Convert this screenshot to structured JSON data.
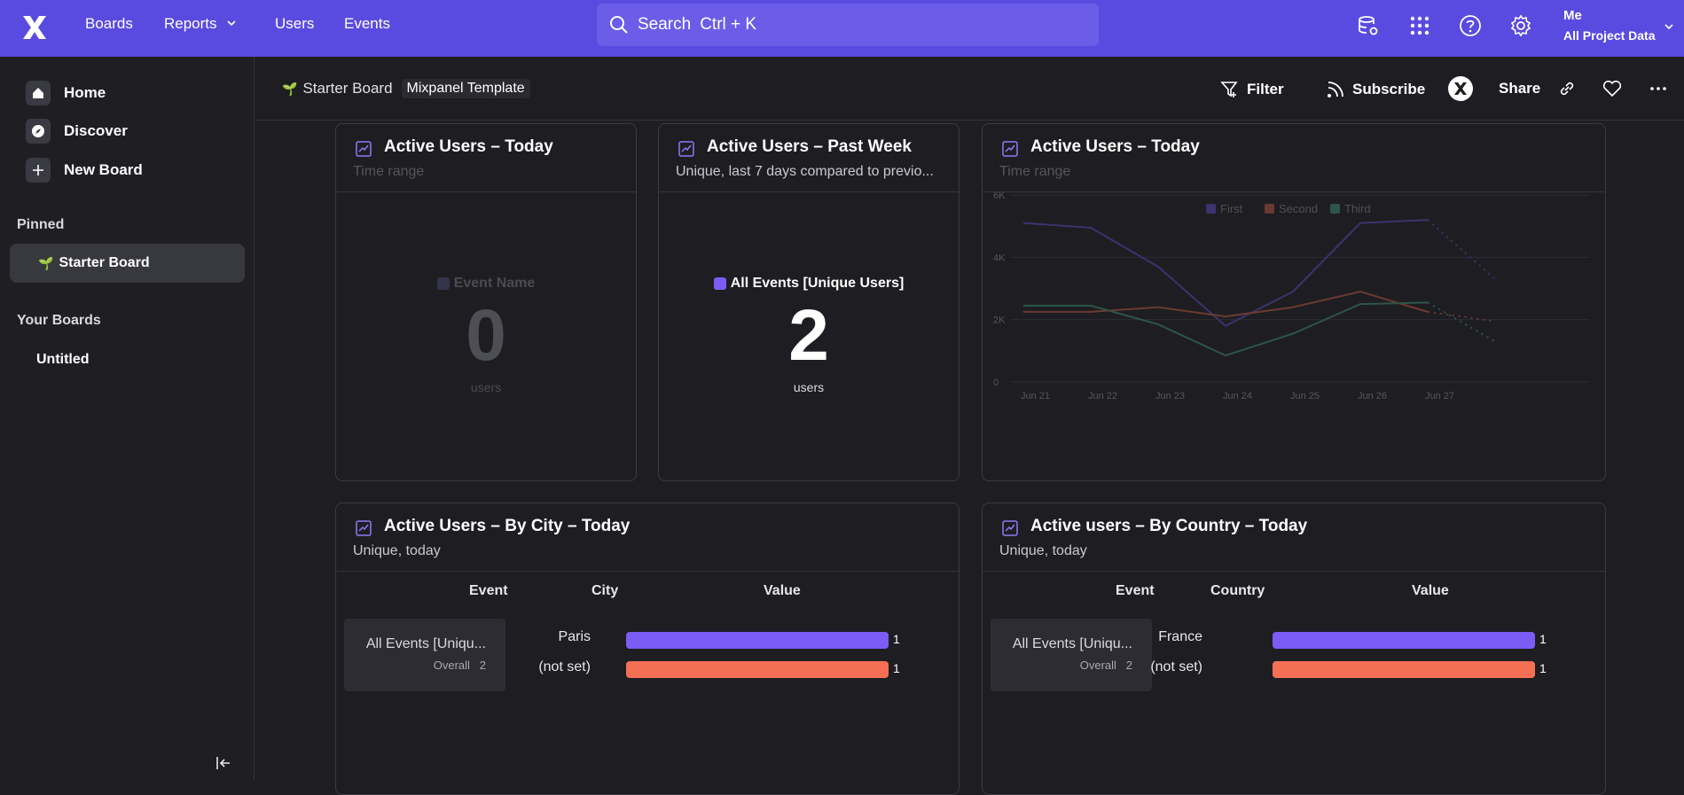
{
  "topbar": {
    "nav": [
      "Boards",
      "Reports",
      "Users",
      "Events"
    ],
    "search_label": "Search",
    "search_shortcut": "Ctrl + K",
    "user_name": "Me",
    "user_project": "All Project Data"
  },
  "sidebar": {
    "items": [
      {
        "label": "Home",
        "icon": "home-icon"
      },
      {
        "label": "Discover",
        "icon": "compass-icon"
      },
      {
        "label": "New Board",
        "icon": "plus-icon"
      }
    ],
    "pinned_heading": "Pinned",
    "pinned_item": "Starter Board",
    "boards_heading": "Your Boards",
    "boards": [
      "Untitled"
    ]
  },
  "board": {
    "name": "Starter Board",
    "template_tag": "Mixpanel Template",
    "actions": {
      "filter": "Filter",
      "subscribe": "Subscribe",
      "share": "Share"
    }
  },
  "cards": {
    "today": {
      "title": "Active Users – Today",
      "subtitle": "Time range",
      "metric_label": "Event Name",
      "metric_value": "0",
      "metric_unit": "users"
    },
    "week": {
      "title": "Active Users – Past Week",
      "subtitle": "Unique, last 7 days compared to previo...",
      "metric_label": "All Events [Unique Users]",
      "metric_value": "2",
      "metric_unit": "users"
    },
    "line": {
      "title": "Active Users – Today",
      "subtitle": "Time range"
    },
    "city": {
      "title": "Active Users – By City – Today",
      "subtitle": "Unique, today",
      "headers": [
        "Event",
        "City",
        "Value"
      ],
      "event_name": "All Events [Uniqu...",
      "overall_label": "Overall",
      "overall_value": "2",
      "rows": [
        {
          "label": "Paris",
          "value": "1",
          "color": "#7b5cf5"
        },
        {
          "label": "(not set)",
          "value": "1",
          "color": "#f56f55"
        }
      ]
    },
    "country": {
      "title": "Active users – By Country – Today",
      "subtitle": "Unique, today",
      "headers": [
        "Event",
        "Country",
        "Value"
      ],
      "event_name": "All Events [Uniqu...",
      "overall_label": "Overall",
      "overall_value": "2",
      "rows": [
        {
          "label": "France",
          "value": "1",
          "color": "#7b5cf5"
        },
        {
          "label": "(not set)",
          "value": "1",
          "color": "#f56f55"
        }
      ]
    }
  },
  "chart_data": {
    "type": "line",
    "categories": [
      "Jun 21",
      "Jun 22",
      "Jun 23",
      "Jun 24",
      "Jun 25",
      "Jun 26",
      "Jun 27",
      ""
    ],
    "yticks": [
      "0",
      "2K",
      "4K",
      "6K"
    ],
    "ylim": [
      0,
      6000
    ],
    "legend": [
      "First",
      "Second",
      "Third"
    ],
    "legend_position": "top-center",
    "series": [
      {
        "name": "First",
        "color": "#3a3470",
        "values": [
          5100,
          4950,
          3700,
          1800,
          2900,
          5100,
          5200,
          3300
        ]
      },
      {
        "name": "Second",
        "color": "#6a3a32",
        "values": [
          2250,
          2250,
          2400,
          2100,
          2400,
          2900,
          2250,
          1950
        ]
      },
      {
        "name": "Third",
        "color": "#2f5548",
        "values": [
          2450,
          2450,
          1850,
          850,
          1550,
          2500,
          2550,
          1300
        ]
      }
    ]
  }
}
